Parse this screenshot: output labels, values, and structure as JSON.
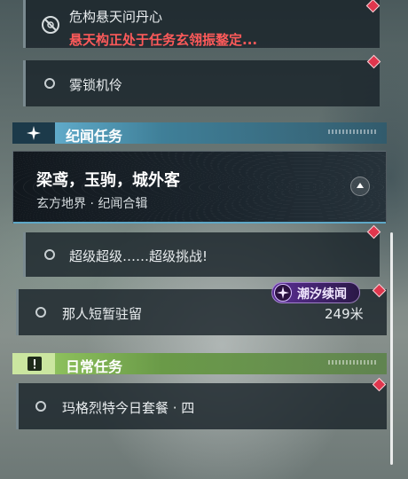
{
  "quests": {
    "top_active": {
      "title": "危构悬天问丹心",
      "subtitle": "悬天构正处于任务玄翎振鍪定..."
    },
    "top_step": {
      "label": "雾锁机伶"
    },
    "story_section": {
      "label": "纪闻任务"
    },
    "featured": {
      "title": "梁鸢，玉驹，城外客",
      "subtitle": "玄方地界 · 纪闻合辑"
    },
    "story_step": {
      "label": "超级超级……超级挑战!"
    },
    "event_step": {
      "label": "那人短暂驻留",
      "distance": "249米",
      "badge": "潮汐续闻"
    },
    "daily_section": {
      "label": "日常任务"
    },
    "daily_step": {
      "label": "玛格烈特今日套餐 · 四"
    }
  },
  "colors": {
    "story_accent": "#7fd1ee",
    "daily_accent": "#a8d070",
    "marker": "#e0364d",
    "warning_text": "#ff5a5a"
  },
  "icons": {
    "story_header_icon": "sparkle-icon",
    "daily_header_icon": "exclamation-icon",
    "top_active_icon": "no-entry-icon",
    "badge_icon": "tide-star-icon"
  }
}
